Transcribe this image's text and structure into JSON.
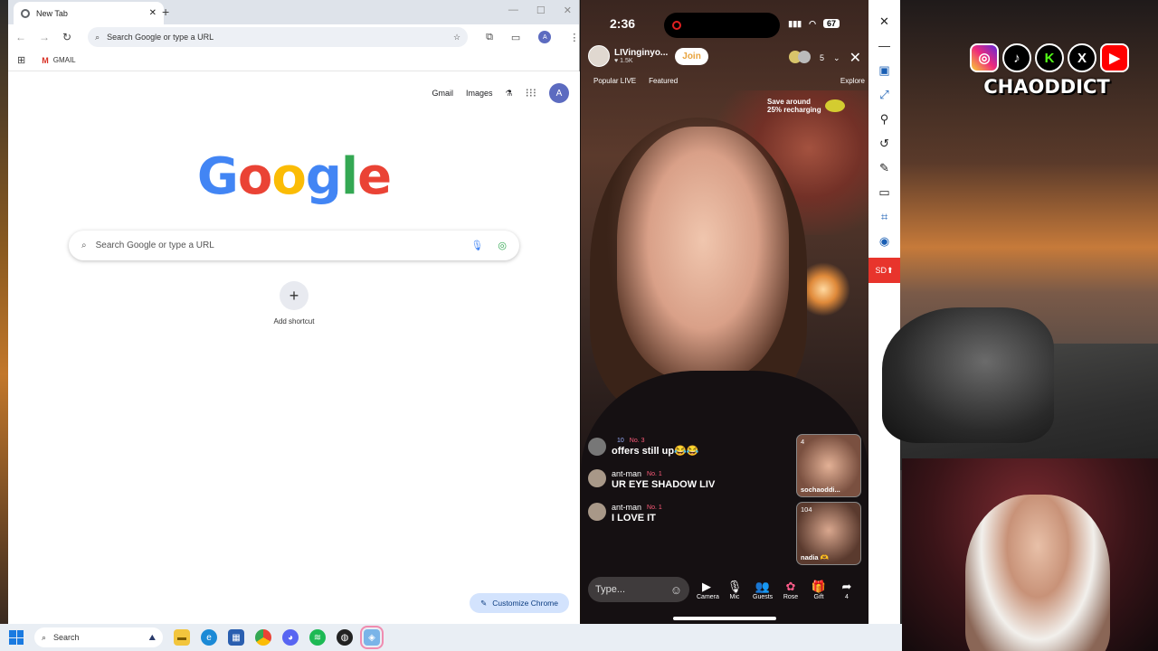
{
  "chrome": {
    "tab_title": "New Tab",
    "tab_close": "✕",
    "new_tab": "+",
    "window_controls": [
      "—",
      "☐",
      "✕"
    ],
    "omnibox_placeholder": "Search Google or type a URL",
    "bookmark_gmail": "GMAIL",
    "profile_initial": "A",
    "ntp": {
      "link_gmail": "Gmail",
      "link_images": "Images",
      "logo_letters": [
        {
          "char": "G",
          "color": "#4285F4"
        },
        {
          "char": "o",
          "color": "#EA4335"
        },
        {
          "char": "o",
          "color": "#FBBC05"
        },
        {
          "char": "g",
          "color": "#4285F4"
        },
        {
          "char": "l",
          "color": "#34A853"
        },
        {
          "char": "e",
          "color": "#EA4335"
        }
      ],
      "search_placeholder": "Search Google or type a URL",
      "add_shortcut": "Add shortcut",
      "customize": "Customize Chrome"
    }
  },
  "tiktok": {
    "time": "2:36",
    "battery": "67",
    "host_name": "LIVinginyo...",
    "host_likes": "1.5K",
    "join": "Join",
    "viewer_count": "5",
    "chip_popular": "Popular LIVE",
    "chip_featured": "Featured",
    "chip_explore": "Explore",
    "recharge_line1": "Save around",
    "recharge_line2": "25% recharging",
    "messages": [
      {
        "user": "",
        "level": "10",
        "rank": "No. 3",
        "text": "offers still up😂😂"
      },
      {
        "user": "ant-man",
        "level": "",
        "rank": "No. 1",
        "text": "UR EYE SHADOW LIV"
      },
      {
        "user": "ant-man",
        "level": "",
        "rank": "No. 1",
        "text": "I LOVE IT"
      }
    ],
    "guests": [
      {
        "count": "4",
        "name": "sochaoddi..."
      },
      {
        "count": "104",
        "name": "nadia 🫶"
      }
    ],
    "type_placeholder": "Type...",
    "actions": [
      {
        "icon": "camera-icon",
        "label": "Camera"
      },
      {
        "icon": "mic-icon",
        "label": "Mic"
      },
      {
        "icon": "guests-icon",
        "label": "Guests"
      },
      {
        "icon": "rose-icon",
        "label": "Rose"
      },
      {
        "icon": "gift-icon",
        "label": "Gift"
      },
      {
        "icon": "share-icon",
        "label": "4"
      }
    ]
  },
  "sidetools": {
    "sd_label": "SD"
  },
  "overlay": {
    "brand": "CHAODDICT"
  },
  "taskbar": {
    "search_label": "Search"
  }
}
